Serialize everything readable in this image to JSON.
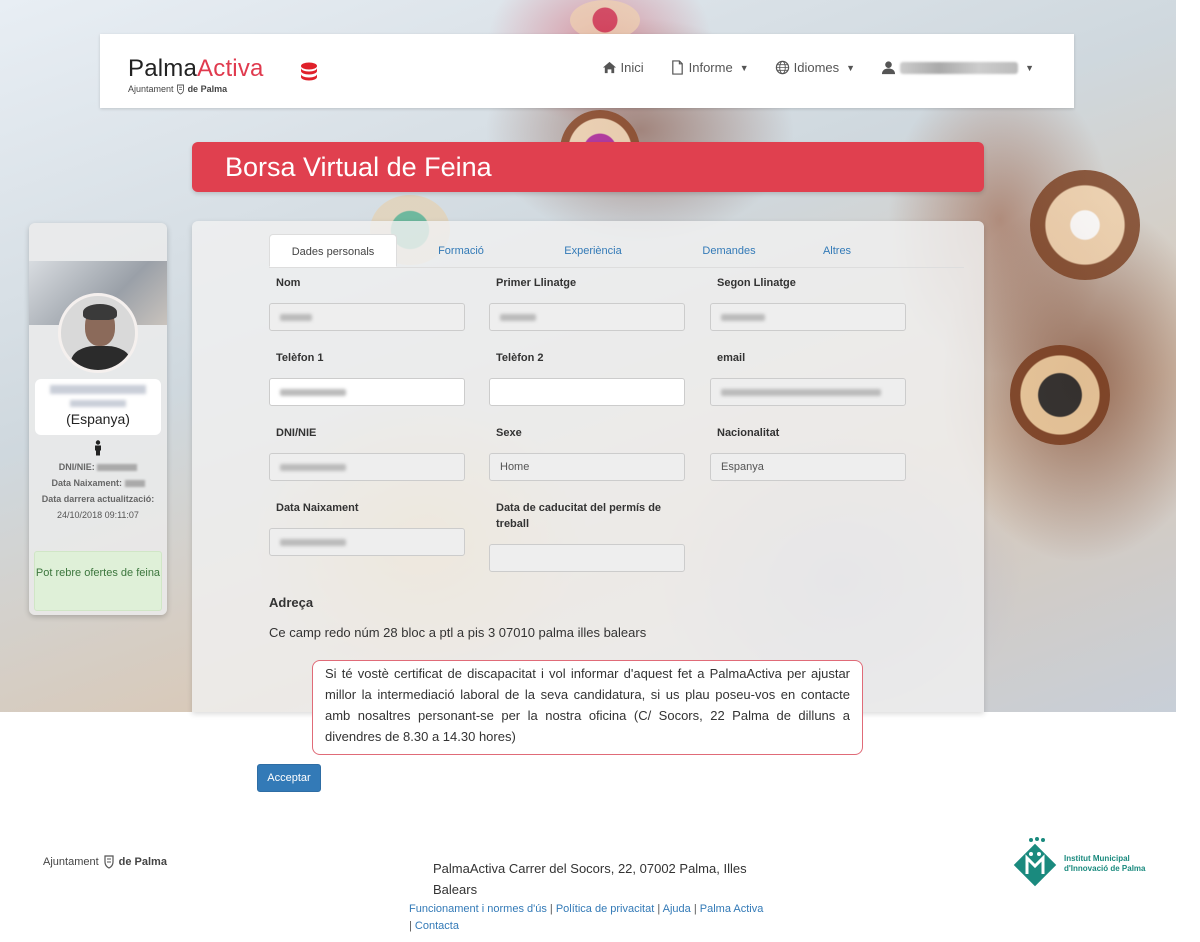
{
  "brand": {
    "main_a": "Palma",
    "main_b": "Activa",
    "sub_a": "Ajuntament",
    "sub_b": "de Palma"
  },
  "colors": {
    "accent": "#e0404f",
    "link": "#337ab7",
    "success_bg": "#dff0d8",
    "success_text": "#3c763d",
    "footer_teal": "#1a8a7e"
  },
  "nav": {
    "items": [
      {
        "label": "Inici",
        "icon": "home-icon"
      },
      {
        "label": "Informe",
        "icon": "file-icon",
        "dropdown": true
      },
      {
        "label": "Idiomes",
        "icon": "globe-icon",
        "dropdown": true
      }
    ],
    "user_icon": "user-icon"
  },
  "page": {
    "title": "Borsa Virtual de Feina"
  },
  "profile": {
    "country": "(Espanya)",
    "dni_label": "DNI/NIE:",
    "birth_label": "Data Naixament:",
    "updated_label": "Data darrera actualització:",
    "updated_value": "24/10/2018 09:11:07",
    "offers_status": "Pot rebre ofertes de feina"
  },
  "tabs": [
    {
      "label": "Dades personals",
      "active": true
    },
    {
      "label": "Formació",
      "active": false
    },
    {
      "label": "Experiència",
      "active": false
    },
    {
      "label": "Demandes",
      "active": false
    },
    {
      "label": "Altres",
      "active": false
    }
  ],
  "form": {
    "nom": {
      "label": "Nom"
    },
    "llinatge1": {
      "label": "Primer Llinatge"
    },
    "llinatge2": {
      "label": "Segon Llinatge"
    },
    "tel1": {
      "label": "Telèfon 1"
    },
    "tel2": {
      "label": "Telèfon 2",
      "value": ""
    },
    "email": {
      "label": "email"
    },
    "dni": {
      "label": "DNI/NIE"
    },
    "sexe": {
      "label": "Sexe",
      "value": "Home"
    },
    "nacionalitat": {
      "label": "Nacionalitat",
      "value": "Espanya"
    },
    "naixement": {
      "label": "Data Naixament"
    },
    "caducitat": {
      "label": "Data de caducitat del permís de treball",
      "value": ""
    }
  },
  "address": {
    "title": "Adreça",
    "text": "Ce camp redo núm 28 bloc a ptl a pis 3 07010 palma illes balears"
  },
  "notice": "Si té vostè certificat de discapacitat i vol informar d'aquest fet a PalmaActiva per ajustar millor la intermediació laboral de la seva candidatura, si us plau poseu-vos en contacte amb nosaltres personant-se per la nostra oficina (C/ Socors, 22 Palma de dilluns a divendres de 8.30 a 14.30 hores)",
  "accept_label": "Acceptar",
  "footer": {
    "left_a": "Ajuntament",
    "left_b": "de Palma",
    "address": "PalmaActiva Carrer del Socors, 22, 07002 Palma, Illes Balears",
    "links": [
      "Funcionament i normes d'ús",
      "Política de privacitat",
      "Ajuda",
      "Palma Activa",
      "Contacta"
    ],
    "separator": "|",
    "imi_line1": "Institut Municipal",
    "imi_line2": "d'Innovació de Palma"
  }
}
